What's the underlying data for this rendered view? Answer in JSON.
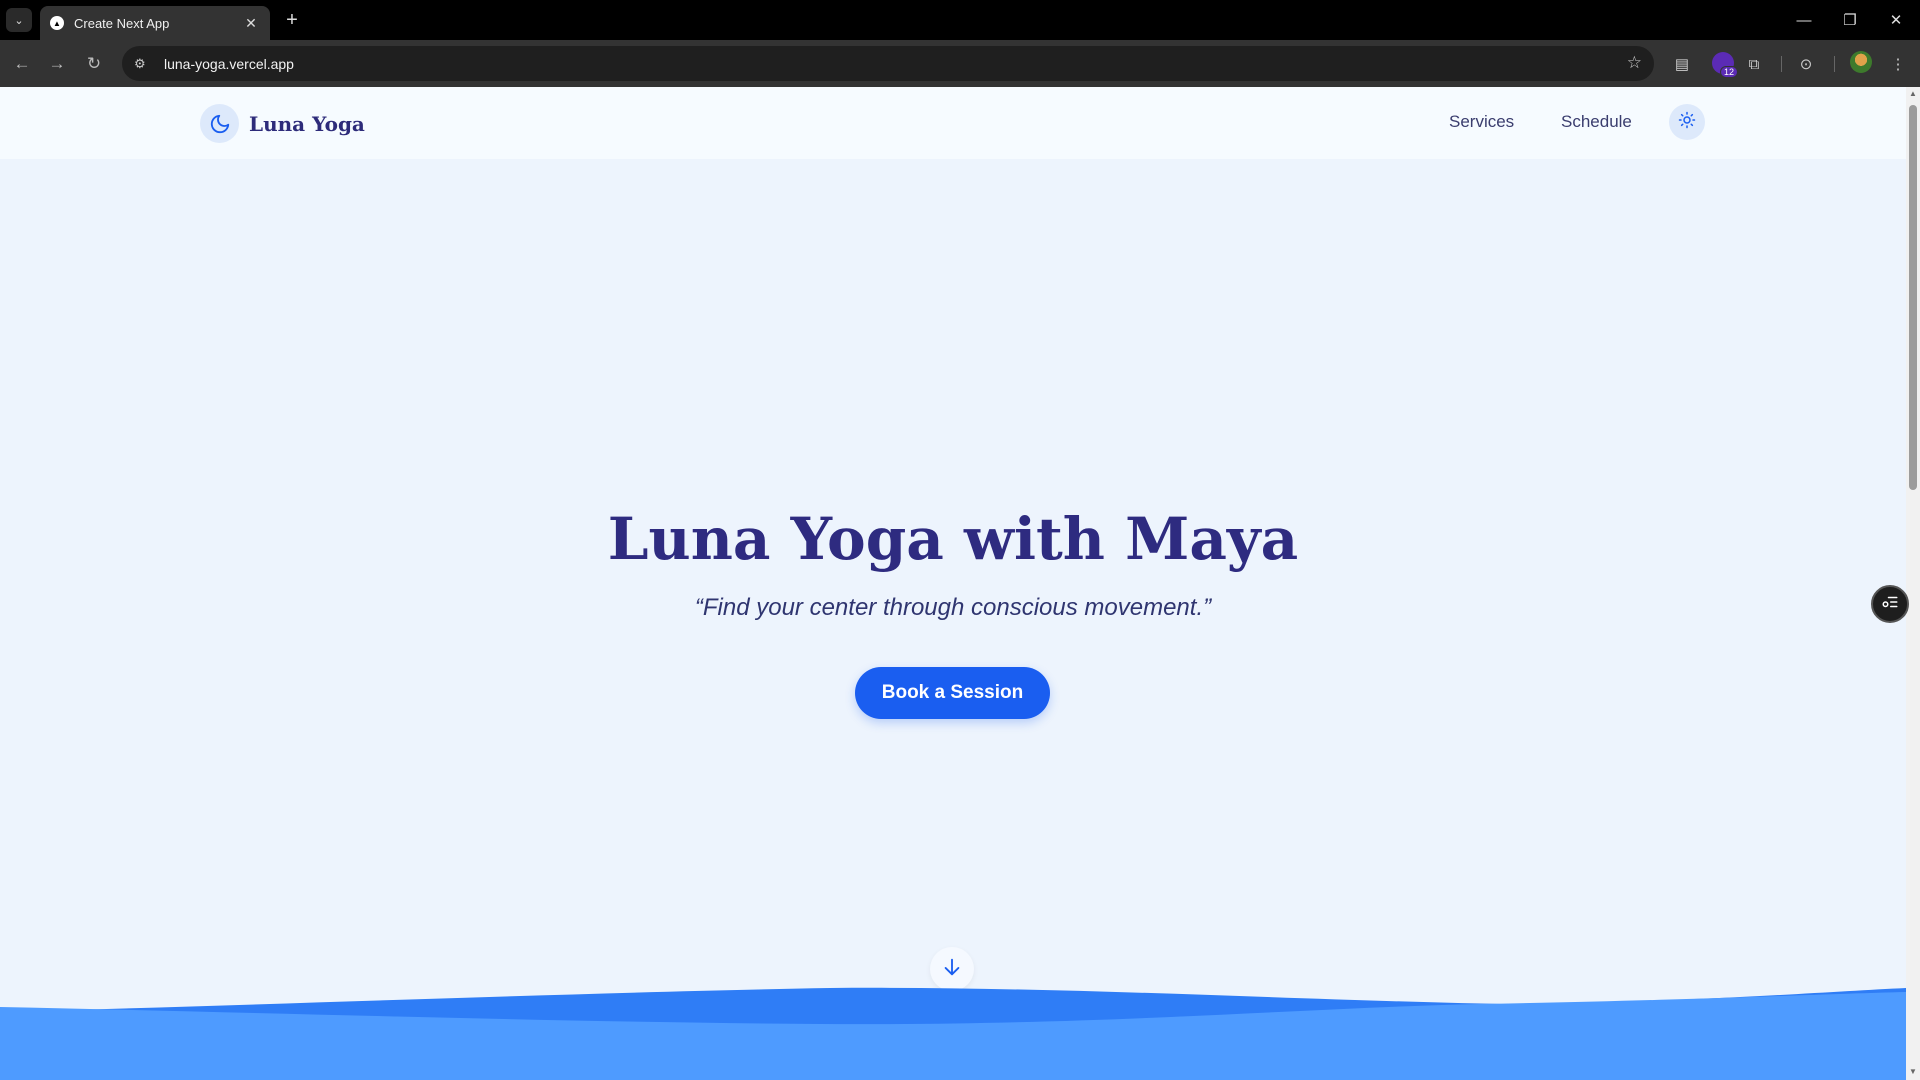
{
  "browser": {
    "tab": {
      "title": "Create Next App",
      "favicon": "vercel-triangle-icon"
    },
    "address_bar": {
      "url": "luna-yoga.vercel.app"
    },
    "extensions_badge_count": "12"
  },
  "site": {
    "brand": {
      "name": "Luna Yoga",
      "icon": "moon-icon"
    },
    "nav": {
      "services": "Services",
      "schedule": "Schedule"
    },
    "theme_toggle_icon": "sun-icon"
  },
  "hero": {
    "title_strong": "Luna Yoga",
    "title_rest": " with Maya",
    "tagline": "“Find your center through conscious movement.”",
    "cta_label": "Book a Session",
    "scroll_icon": "arrow-down-icon"
  },
  "colors": {
    "accent": "#1a5ef0",
    "heading": "#2e2b80",
    "background": "#edf4fd",
    "wave_front": "#4e9bff",
    "wave_back": "#2f7df6"
  }
}
